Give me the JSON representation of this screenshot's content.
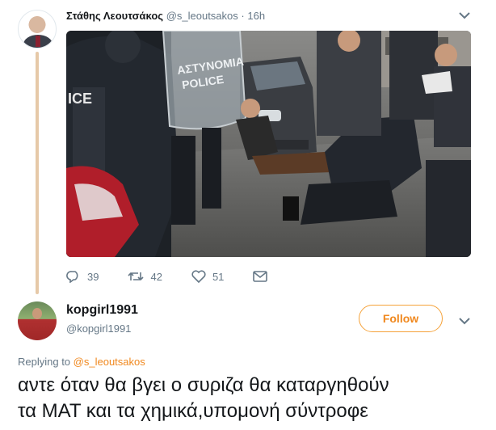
{
  "tweet1": {
    "author_name": "Στάθης Λεουτσάκος",
    "handle": "@s_leoutsakos",
    "separator": "·",
    "time": "16h",
    "photo": {
      "shield_text_line1": "ΑΣΤΥΝΟΜΙΑ",
      "shield_text_line2": "POLICE",
      "vest_text": "ICE"
    },
    "actions": {
      "replies": "39",
      "retweets": "42",
      "likes": "51"
    }
  },
  "tweet2": {
    "author_name": "kopgirl1991",
    "handle": "@kopgirl1991",
    "follow_label": "Follow",
    "replying_prefix": "Replying to",
    "replying_to": "@s_leoutsakos",
    "text_line1": "αντε όταν θα βγει ο συριζα θα καταργηθούν",
    "text_line2": "τα ΜΑΤ και τα χημικά,υπομονή σύντροφε"
  },
  "colors": {
    "accent": "#f0881e",
    "thread_line": "#e6c9a8",
    "muted": "#657786",
    "text": "#14171a"
  },
  "icons": [
    "reply-icon",
    "retweet-icon",
    "like-icon",
    "message-icon",
    "chevron-down-icon"
  ]
}
